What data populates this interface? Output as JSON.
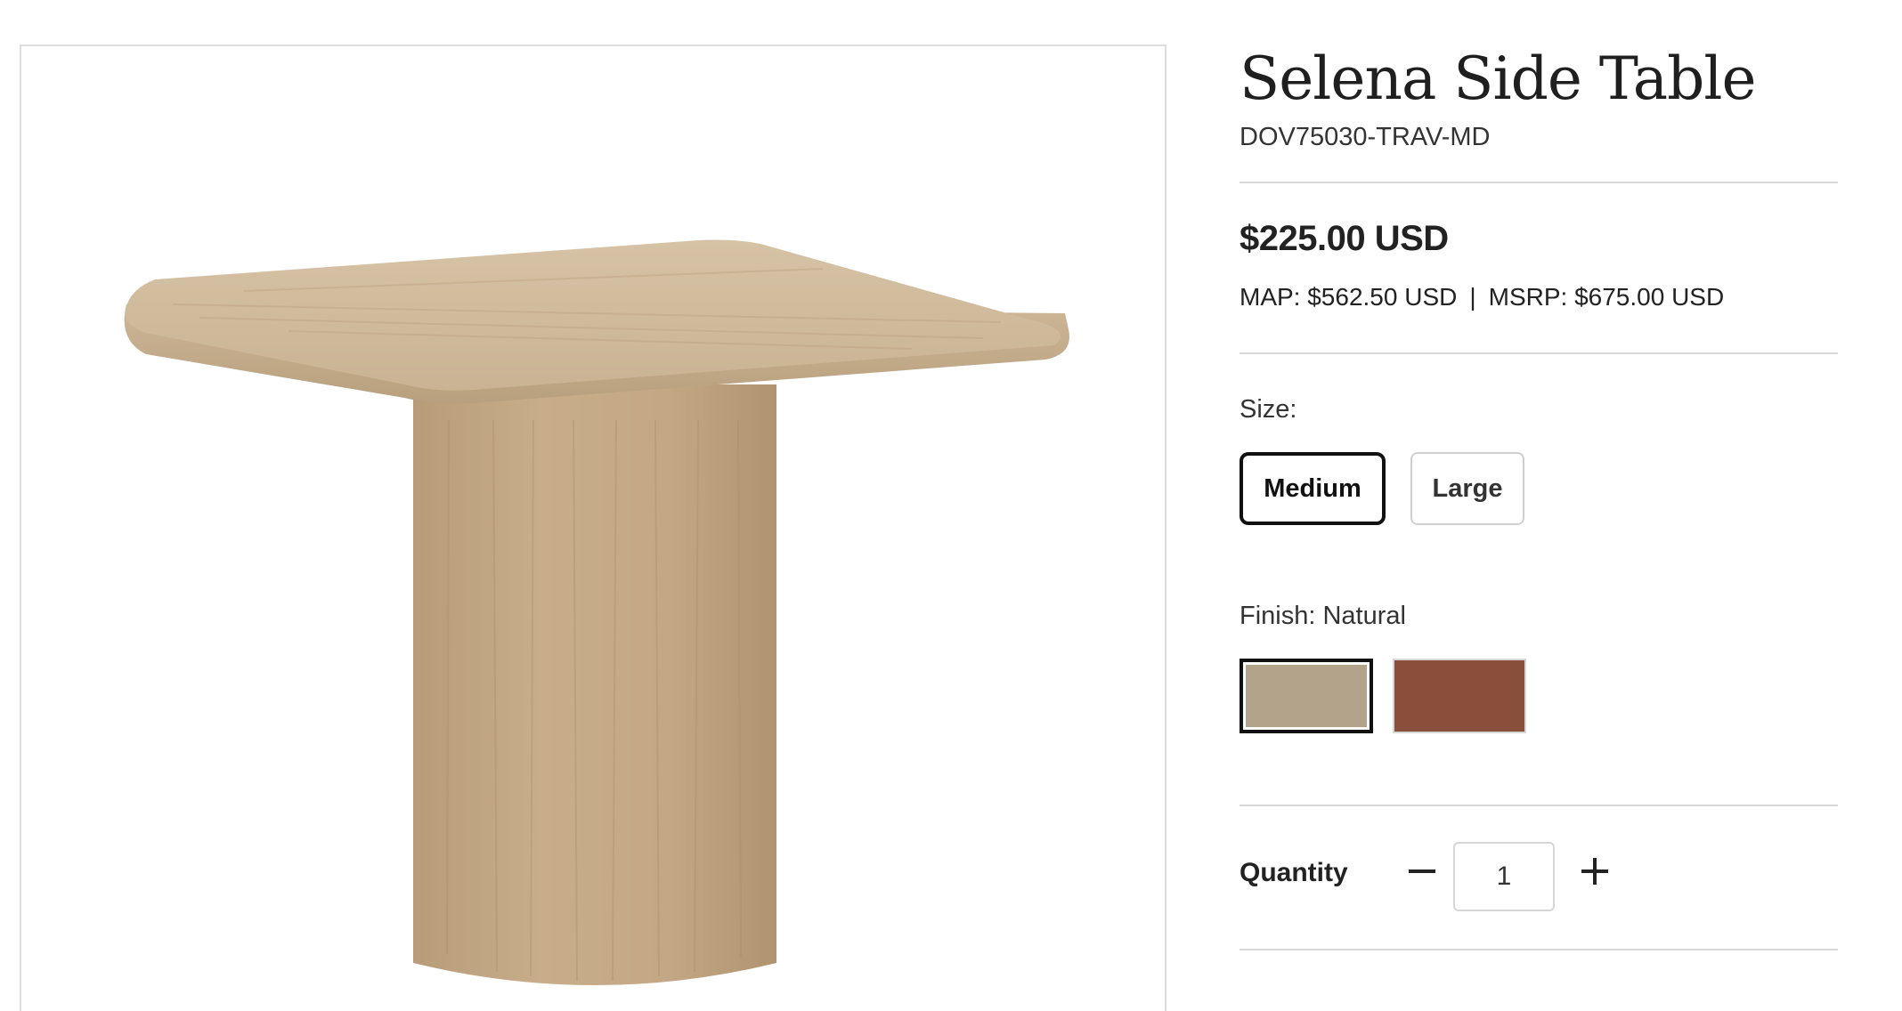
{
  "product": {
    "title": "Selena Side Table",
    "sku": "DOV75030-TRAV-MD",
    "price": "$225.00 USD",
    "map_price": "MAP: $562.50 USD",
    "separator": "|",
    "msrp_price": "MSRP: $675.00 USD",
    "image_icon": "travertine-side-table-image"
  },
  "size": {
    "label": "Size:",
    "options": [
      "Medium",
      "Large"
    ],
    "selected": "Medium"
  },
  "finish": {
    "label": "Finish: Natural",
    "swatches": [
      {
        "name": "Natural",
        "color": "#b3a38a",
        "selected": true
      },
      {
        "name": "Brown",
        "color": "#8a4f3b",
        "selected": false
      }
    ]
  },
  "quantity": {
    "label": "Quantity",
    "value": "1",
    "minus_icon": "minus-icon",
    "plus_icon": "plus-icon"
  }
}
